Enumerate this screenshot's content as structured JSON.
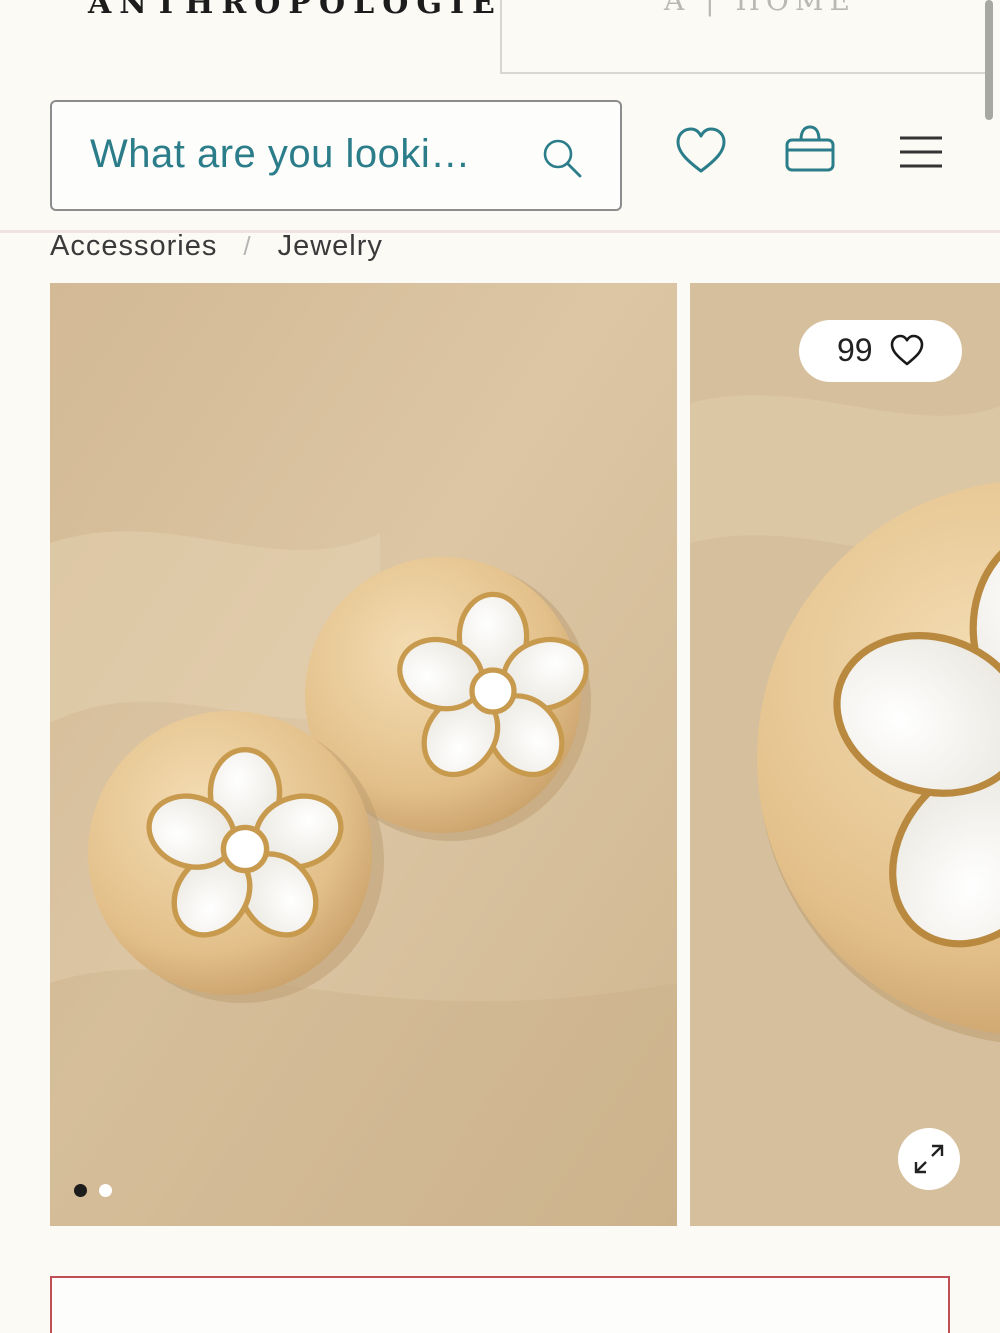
{
  "brand": {
    "logo_text": "ANTHROPOLOGIE",
    "home_tab_label": "A | HOME"
  },
  "header": {
    "search_placeholder": "What are you looki…",
    "icons": [
      "search-icon",
      "heart-icon",
      "shopping-bag-icon",
      "hamburger-menu-icon"
    ]
  },
  "breadcrumb": {
    "items": [
      "Accessories",
      "Jewelry"
    ],
    "separator": "/"
  },
  "gallery": {
    "favorite_count": "99",
    "active_slide": 1,
    "slide_count": 2,
    "icons": [
      "heart-outline-icon",
      "expand-icon"
    ]
  },
  "colors": {
    "accent_teal": "#2b7d8a",
    "background": "#fbfaf5",
    "promo_border": "#c04f55",
    "gold": "#e4c28c",
    "backdrop": "#d5bd97"
  }
}
